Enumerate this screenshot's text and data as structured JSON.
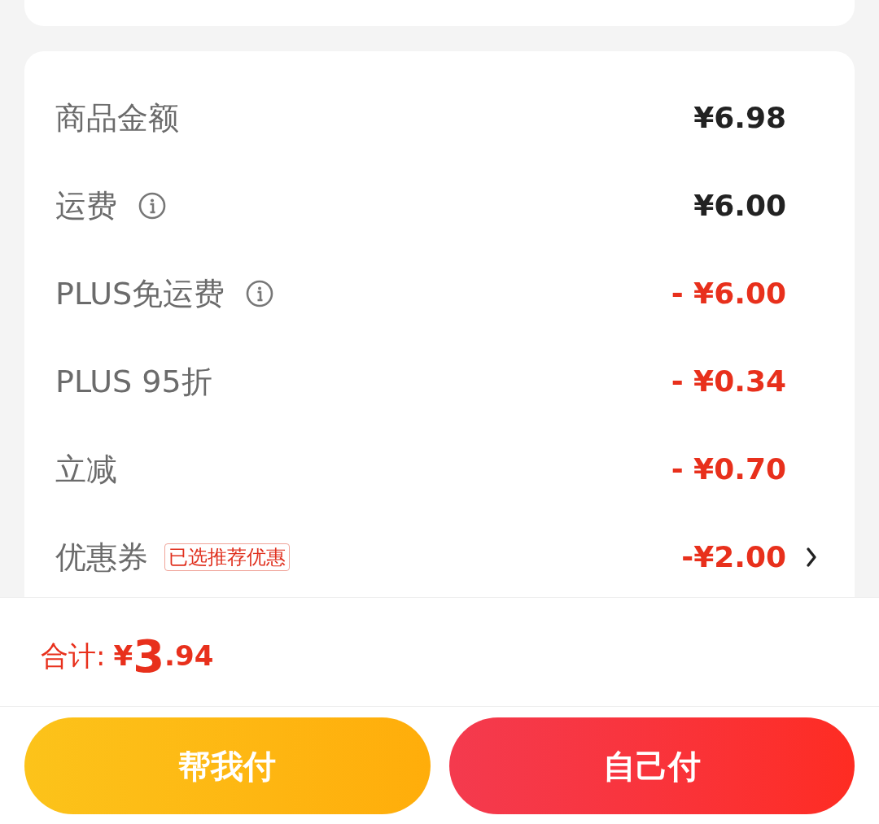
{
  "fee_rows": [
    {
      "label": "商品金额",
      "info": false,
      "amount": "¥6.98",
      "kind": "normal",
      "chevron": false
    },
    {
      "label": "运费",
      "info": true,
      "amount": "¥6.00",
      "kind": "normal",
      "chevron": false
    },
    {
      "label": "PLUS免运费",
      "info": true,
      "amount": "- ¥6.00",
      "kind": "discount",
      "chevron": false
    },
    {
      "label": "PLUS 95折",
      "info": false,
      "amount": "- ¥0.34",
      "kind": "discount",
      "chevron": false
    },
    {
      "label": "立减",
      "info": false,
      "amount": "- ¥0.70",
      "kind": "discount",
      "chevron": false
    },
    {
      "label": "优惠券",
      "info": false,
      "tag": "已选推荐优惠",
      "amount": "-¥2.00",
      "kind": "discount",
      "chevron": true
    }
  ],
  "total": {
    "label": "合计:",
    "currency": "¥",
    "integer": "3",
    "decimal": ".94"
  },
  "buttons": [
    {
      "label": "帮我付",
      "kind": "secondary"
    },
    {
      "label": "自己付",
      "kind": "primary"
    }
  ]
}
